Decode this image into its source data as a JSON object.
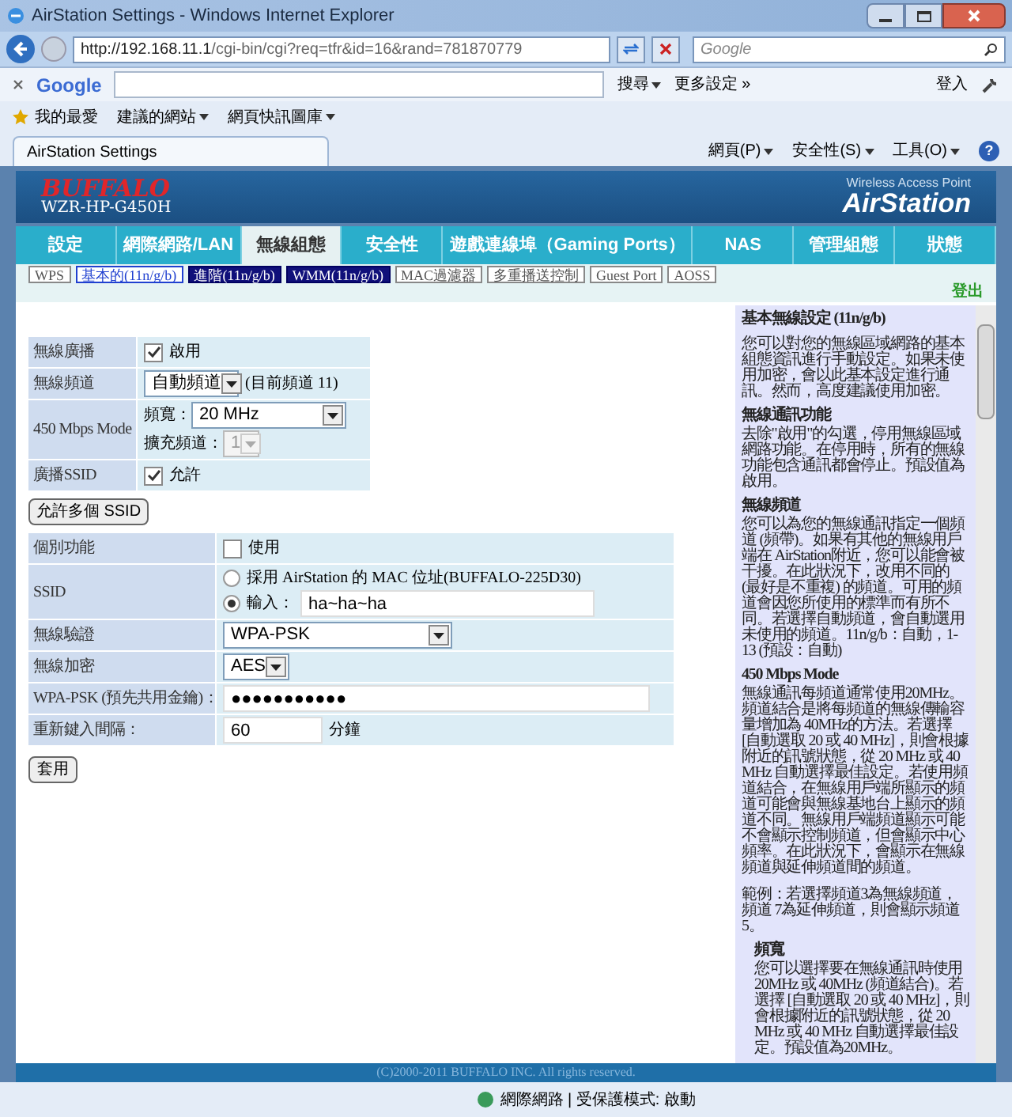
{
  "browser": {
    "title": "AirStation Settings - Windows Internet Explorer",
    "address_host": "http://192.168.11.1",
    "address_path": "/cgi-bin/cgi?req=tfr&id=16&rand=781870779",
    "search_placeholder": "Google",
    "google_toolbar": {
      "brand": "Google",
      "search_button": "搜尋",
      "more": "更多設定 »",
      "login": "登入"
    },
    "favorites": {
      "label": "我的最愛",
      "items": [
        "建議的網站",
        "網頁快訊圖庫"
      ]
    },
    "tab": "AirStation Settings",
    "commands": [
      "網頁(P)",
      "安全性(S)",
      "工具(O)"
    ],
    "help_symbol": "?"
  },
  "header": {
    "brand": "BUFFALO",
    "model": "WZR-HP-G450H",
    "tagline": "Wireless Access Point",
    "product": "AirStation"
  },
  "nav": [
    {
      "label": "設定",
      "selected": false
    },
    {
      "label": "網際網路/LAN",
      "selected": false
    },
    {
      "label": "無線組態",
      "selected": true
    },
    {
      "label": "安全性",
      "selected": false
    },
    {
      "label": "遊戲連線埠（Gaming Ports）",
      "selected": false
    },
    {
      "label": "NAS",
      "selected": false
    },
    {
      "label": "管理組態",
      "selected": false
    },
    {
      "label": "狀態",
      "selected": false
    }
  ],
  "subnav": [
    {
      "label": "WPS",
      "kind": "plain",
      "selected": false
    },
    {
      "label": "基本的(11n/g/b)",
      "kind": "plain",
      "selected": true
    },
    {
      "label": "進階(11n/g/b)",
      "kind": "dark",
      "selected": false
    },
    {
      "label": "WMM(11n/g/b)",
      "kind": "dark",
      "selected": false
    },
    {
      "label": "MAC過濾器",
      "kind": "plain",
      "selected": false
    },
    {
      "label": "多重播送控制",
      "kind": "plain",
      "selected": false
    },
    {
      "label": "Guest Port",
      "kind": "plain",
      "selected": false
    },
    {
      "label": "AOSS",
      "kind": "plain",
      "selected": false
    }
  ],
  "logout": "登出",
  "basic_rows": [
    {
      "label": "無線廣播",
      "kind": "checkbox",
      "checked": true,
      "text": "啟用"
    },
    {
      "label": "無線頻道",
      "kind": "select",
      "value": "自動頻道",
      "note": "(目前頻道 11)"
    },
    {
      "label": "450 Mbps Mode",
      "kind": "stack",
      "fields": [
        {
          "label": "頻寬：",
          "value": "20 MHz",
          "disabled": false
        },
        {
          "label": "擴充頻道：",
          "value": "1",
          "disabled": true
        }
      ]
    },
    {
      "label": "廣播SSID",
      "kind": "checkbox",
      "checked": true,
      "text": "允許"
    }
  ],
  "multi_ssid_button": "允許多個 SSID",
  "security_rows": [
    {
      "label": "個別功能",
      "kind": "checkbox",
      "checked": false,
      "text": "使用"
    },
    {
      "label": "SSID",
      "kind": "radios",
      "options": [
        {
          "label": "採用 AirStation 的 MAC 位址(BUFFALO-225D30)",
          "selected": false
        },
        {
          "label": "輸入：",
          "selected": true,
          "value": "ha~ha~ha"
        }
      ]
    },
    {
      "label": "無線驗證",
      "kind": "select",
      "value": "WPA-PSK",
      "wide": true
    },
    {
      "label": "無線加密",
      "kind": "select",
      "value": "AES"
    },
    {
      "label": "WPA-PSK (預先共用金鑰)：",
      "kind": "input",
      "value": "●●●●●●●●●●●",
      "wide": true
    },
    {
      "label": "重新鍵入間隔：",
      "kind": "input",
      "value": "60",
      "suffix": "分鐘"
    }
  ],
  "apply_button": "套用",
  "help": [
    {
      "heading": "基本無線設定 (11n/g/b)",
      "kind": "title",
      "paragraphs": [
        "您可以對您的無線區域網路的基本組態資訊進行手動設定。如果未使用加密，會以此基本設定進行通訊。然而，高度建議使用加密。"
      ]
    },
    {
      "heading": "無線通訊功能",
      "kind": "section",
      "paragraphs": [
        "去除\"啟用\"的勾選，停用無線區域網路功能。在停用時，所有的無線功能包含通訊都會停止。預設值為啟用。"
      ]
    },
    {
      "heading": "無線頻道",
      "kind": "section",
      "paragraphs": [
        "您可以為您的無線通訊指定一個頻道 (頻帶)。如果有其他的無線用戶端在 AirStation附近，您可以能會被干擾。在此狀況下，改用不同的 (最好是不重複) 的頻道。可用的頻道會因您所使用的標準而有所不同。若選擇自動頻道，會自動選用未使用的頻道。11n/g/b：自動，1-13 (預設：自動)"
      ]
    },
    {
      "heading": "450 Mbps Mode",
      "kind": "section",
      "paragraphs": [
        "無線通訊每頻道通常使用20MHz。頻道結合是將每頻道的無線傳輸容量增加為 40MHz的方法。若選擇 [自動選取 20 或 40 MHz]，則會根據附近的訊號狀態，從 20 MHz 或 40 MHz 自動選擇最佳設定。若使用頻道結合，在無線用戶端所顯示的頻道可能會與無線基地台上顯示的頻道不同。無線用戶端頻道顯示可能不會顯示控制頻道，但會顯示中心頻率。在此狀況下，會顯示在無線頻道與延伸頻道間的頻道。",
        "範例：若選擇頻道3為無線頻道，頻道 7為延伸頻道，則會顯示頻道5。"
      ]
    },
    {
      "heading": "頻寬",
      "kind": "sub",
      "paragraphs": [
        "您可以選擇要在無線通訊時使用 20MHz 或 40MHz (頻道結合)。若選擇 [自動選取 20 或 40 MHz]，則會根據附近的訊號狀態，從 20 MHz 或 40 MHz 自動選擇最佳設定。預設值為20MHz。"
      ]
    }
  ],
  "footer": "(C)2000-2011 BUFFALO INC. All rights reserved.",
  "status": "網際網路 | 受保護模式: 啟動"
}
